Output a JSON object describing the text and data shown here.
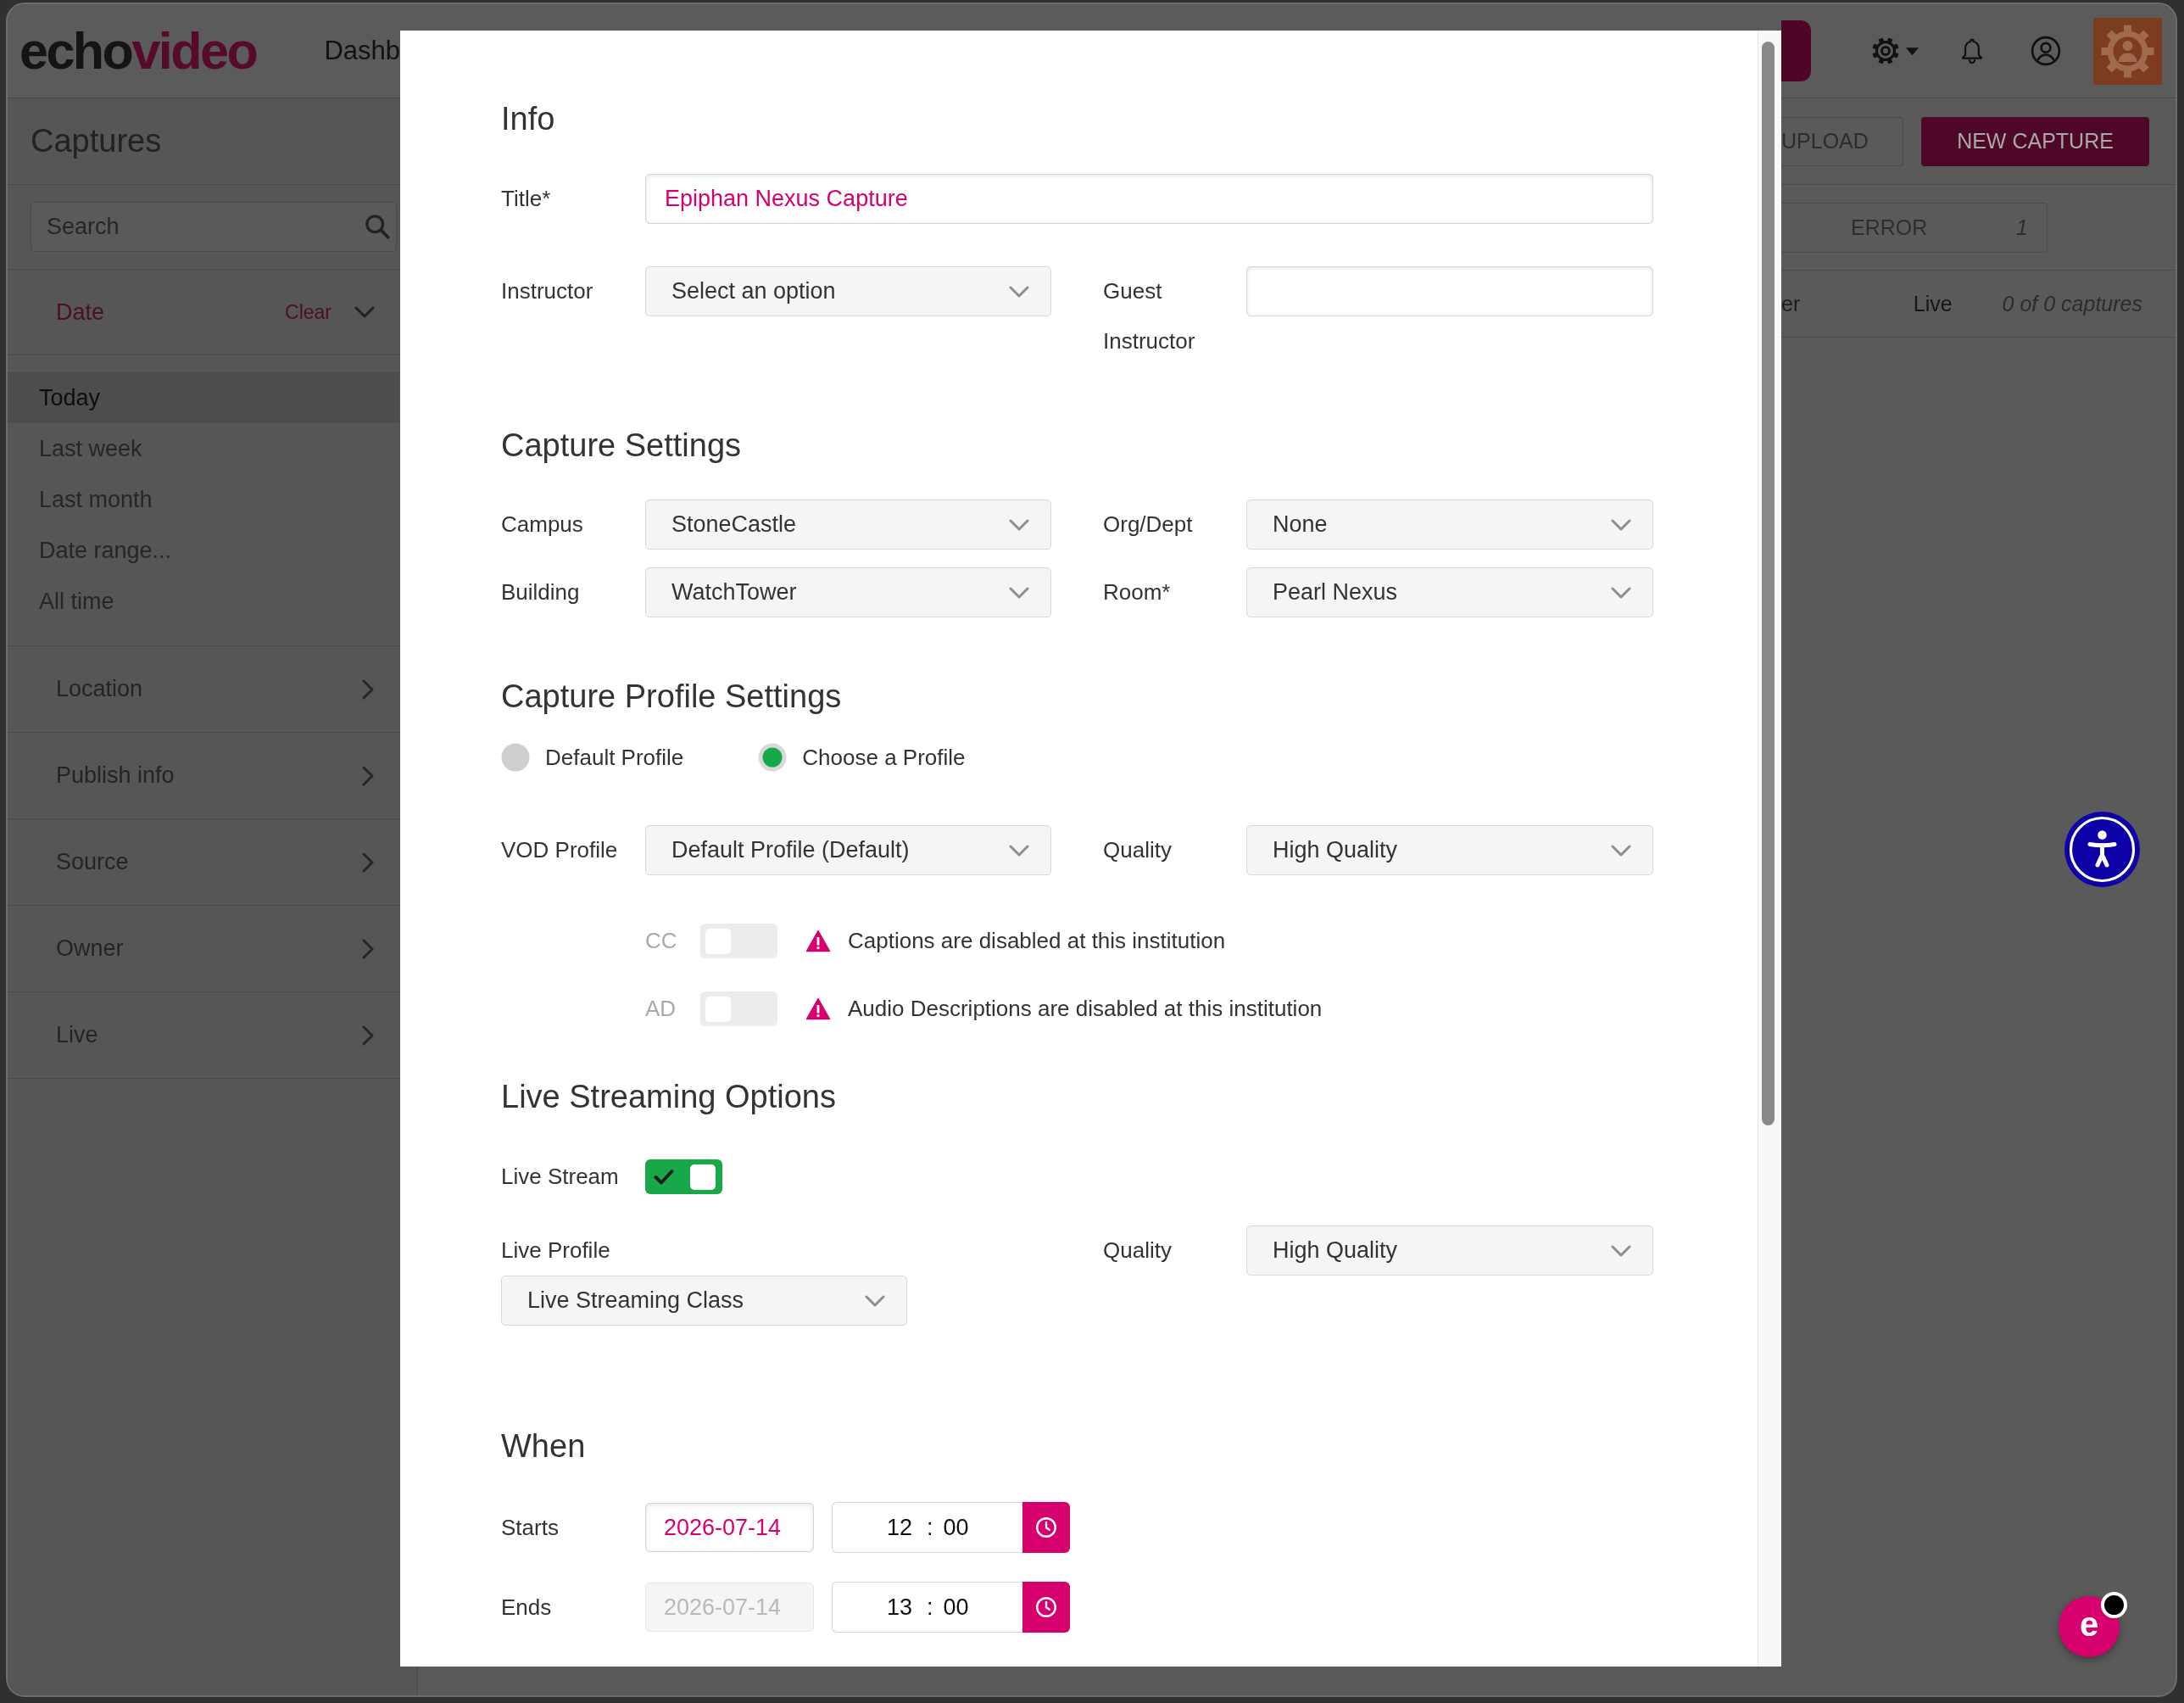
{
  "header": {
    "logo": [
      "echo",
      "video"
    ],
    "nav_link": "Dashb"
  },
  "sidebar": {
    "title": "Captures",
    "search": {
      "placeholder": "Search"
    },
    "date_filter": {
      "label": "Date",
      "clear": "Clear",
      "expanded": true,
      "options": [
        {
          "label": "Today",
          "selected": true
        },
        {
          "label": "Last week",
          "selected": false
        },
        {
          "label": "Last month",
          "selected": false
        },
        {
          "label": "Date range...",
          "selected": false
        },
        {
          "label": "All time",
          "selected": false
        }
      ]
    },
    "sections": [
      {
        "label": "Location",
        "expanded": false
      },
      {
        "label": "Publish info",
        "expanded": false
      },
      {
        "label": "Source",
        "expanded": false
      },
      {
        "label": "Owner",
        "expanded": false
      },
      {
        "label": "Live",
        "expanded": false
      }
    ]
  },
  "toolbar": {
    "actions": [
      {
        "label": "UPLOAD",
        "kind": "outline"
      },
      {
        "label": "NEW CAPTURE",
        "kind": "primary"
      }
    ]
  },
  "status_filters": [
    {
      "label": "ERROR",
      "count": "1"
    }
  ],
  "list_header": {
    "columns": [
      "er",
      "Live"
    ],
    "count": "0 of 0 captures"
  },
  "modal": {
    "info": {
      "heading": "Info",
      "title": {
        "label": "Title*",
        "value": "Epiphan Nexus Capture"
      },
      "instructor": {
        "label": "Instructor",
        "value": "Select an option"
      },
      "guest_instructor": {
        "label": "Guest Instructor"
      }
    },
    "capture_settings": {
      "heading": "Capture Settings",
      "fields": [
        {
          "label": "Campus",
          "value": "StoneCastle"
        },
        {
          "label": "Org/Dept",
          "value": "None"
        },
        {
          "label": "Building",
          "value": "WatchTower"
        },
        {
          "label": "Room*",
          "value": "Pearl Nexus"
        }
      ]
    },
    "capture_profile": {
      "heading": "Capture Profile Settings",
      "profile_options": [
        {
          "label": "Default Profile",
          "selected": false
        },
        {
          "label": "Choose a Profile",
          "selected": true
        }
      ],
      "fields": [
        {
          "label": "VOD Profile",
          "value": "Default Profile (Default)"
        },
        {
          "label": "Quality",
          "value": "High Quality"
        }
      ],
      "accessibility_options": [
        {
          "label": "CC",
          "on": false,
          "disabled": true,
          "warning": "Captions are disabled at this institution"
        },
        {
          "label": "AD",
          "on": false,
          "disabled": true,
          "warning": "Audio Descriptions are disabled at this institution"
        }
      ]
    },
    "live_streaming": {
      "heading": "Live Streaming Options",
      "live_stream": {
        "label": "Live Stream",
        "on": true
      },
      "live_profile": {
        "label": "Live Profile",
        "value": "Live Streaming Class"
      },
      "quality": {
        "label": "Quality",
        "value": "High Quality"
      }
    },
    "when": {
      "heading": "When",
      "rows": [
        {
          "label": "Starts",
          "date": "2026-07-14",
          "date_disabled": false,
          "hour": "12",
          "separator": ":",
          "minute": "00"
        },
        {
          "label": "Ends",
          "date": "2026-07-14",
          "date_disabled": true,
          "hour": "13",
          "separator": ":",
          "minute": "00"
        }
      ]
    }
  },
  "chat_button": {
    "label": "e",
    "notification": true
  }
}
